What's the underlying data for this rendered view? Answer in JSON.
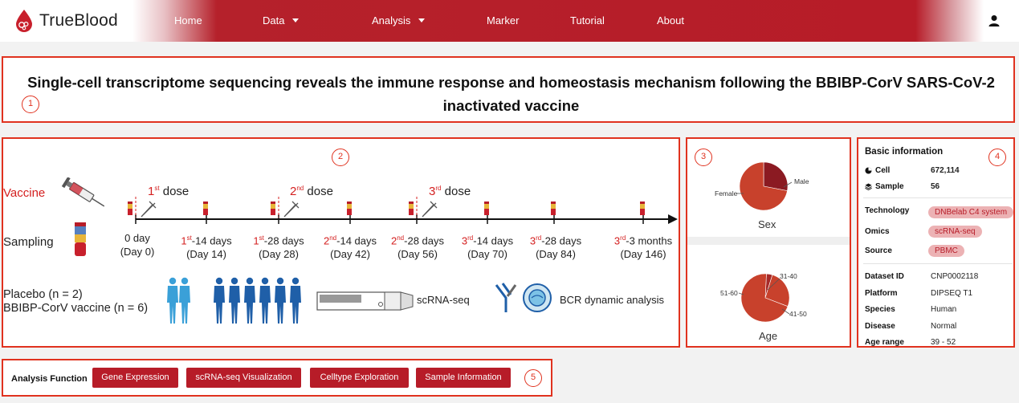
{
  "nav": {
    "brand": "TrueBlood",
    "items": [
      "Home",
      "Data",
      "Analysis",
      "Marker",
      "Tutorial",
      "About"
    ]
  },
  "title": "Single-cell transcriptome sequencing reveals the immune response and homeostasis mechanism following the BBIBP-CorV SARS-CoV-2 inactivated vaccine",
  "badges": [
    "1",
    "2",
    "3",
    "4",
    "5"
  ],
  "design": {
    "vaccine_label": "Vaccine",
    "sampling_label": "Sampling",
    "doses": [
      {
        "sup": "st",
        "num": "1",
        "word": "dose"
      },
      {
        "sup": "nd",
        "num": "2",
        "word": "dose"
      },
      {
        "sup": "rd",
        "num": "3",
        "word": "dose"
      }
    ],
    "timepoints": [
      {
        "red": "",
        "sup": "",
        "main": "0 day",
        "sub": "(Day 0)"
      },
      {
        "red": "1",
        "sup": "st",
        "main": "-14 days",
        "sub": "(Day 14)"
      },
      {
        "red": "1",
        "sup": "st",
        "main": "-28 days",
        "sub": "(Day 28)"
      },
      {
        "red": "2",
        "sup": "nd",
        "main": "-14 days",
        "sub": "(Day 42)"
      },
      {
        "red": "2",
        "sup": "nd",
        "main": "-28 days",
        "sub": "(Day 56)"
      },
      {
        "red": "3",
        "sup": "rd",
        "main": "-14 days",
        "sub": "(Day 70)"
      },
      {
        "red": "3",
        "sup": "rd",
        "main": "-28 days",
        "sub": "(Day 84)"
      },
      {
        "red": "3",
        "sup": "rd",
        "main": "-3 months",
        "sub": "(Day 146)"
      }
    ],
    "placebo": "Placebo (n = 2)",
    "vaccine_group": "BBIBP-CorV vaccine (n = 6)",
    "scrnaseq": "scRNA-seq",
    "bcr": "BCR dynamic analysis"
  },
  "charts": {
    "sex_title": "Sex",
    "age_title": "Age",
    "sex_labels": [
      "Male",
      "Female"
    ],
    "age_labels": [
      "31-40",
      "41-50",
      "51-60"
    ]
  },
  "chart_data": [
    {
      "type": "pie",
      "title": "Sex",
      "labels": [
        "Male",
        "Female"
      ],
      "values": [
        0.28,
        0.72
      ],
      "colors": [
        "#8b1a22",
        "#c8412c"
      ]
    },
    {
      "type": "pie",
      "title": "Age",
      "labels": [
        "31-40",
        "41-50",
        "51-60"
      ],
      "values": [
        0.04,
        0.26,
        0.7
      ],
      "colors": [
        "#a62a28",
        "#c8412c",
        "#c8412c"
      ]
    }
  ],
  "info": {
    "title": "Basic information",
    "cell_label": "Cell",
    "cell_value": "672,114",
    "sample_label": "Sample",
    "sample_value": "56",
    "technology_label": "Technology",
    "technology_value": "DNBelab C4 system",
    "omics_label": "Omics",
    "omics_value": "scRNA-seq",
    "source_label": "Source",
    "source_value": "PBMC",
    "dataset_label": "Dataset ID",
    "dataset_value": "CNP0002118",
    "platform_label": "Platform",
    "platform_value": "DIPSEQ T1",
    "species_label": "Species",
    "species_value": "Human",
    "disease_label": "Disease",
    "disease_value": "Normal",
    "agerange_label": "Age range",
    "agerange_value": "39 - 52"
  },
  "functions": {
    "label": "Analysis Function",
    "buttons": [
      "Gene Expression",
      "scRNA-seq Visualization",
      "Celltype Exploration",
      "Sample Information"
    ]
  }
}
